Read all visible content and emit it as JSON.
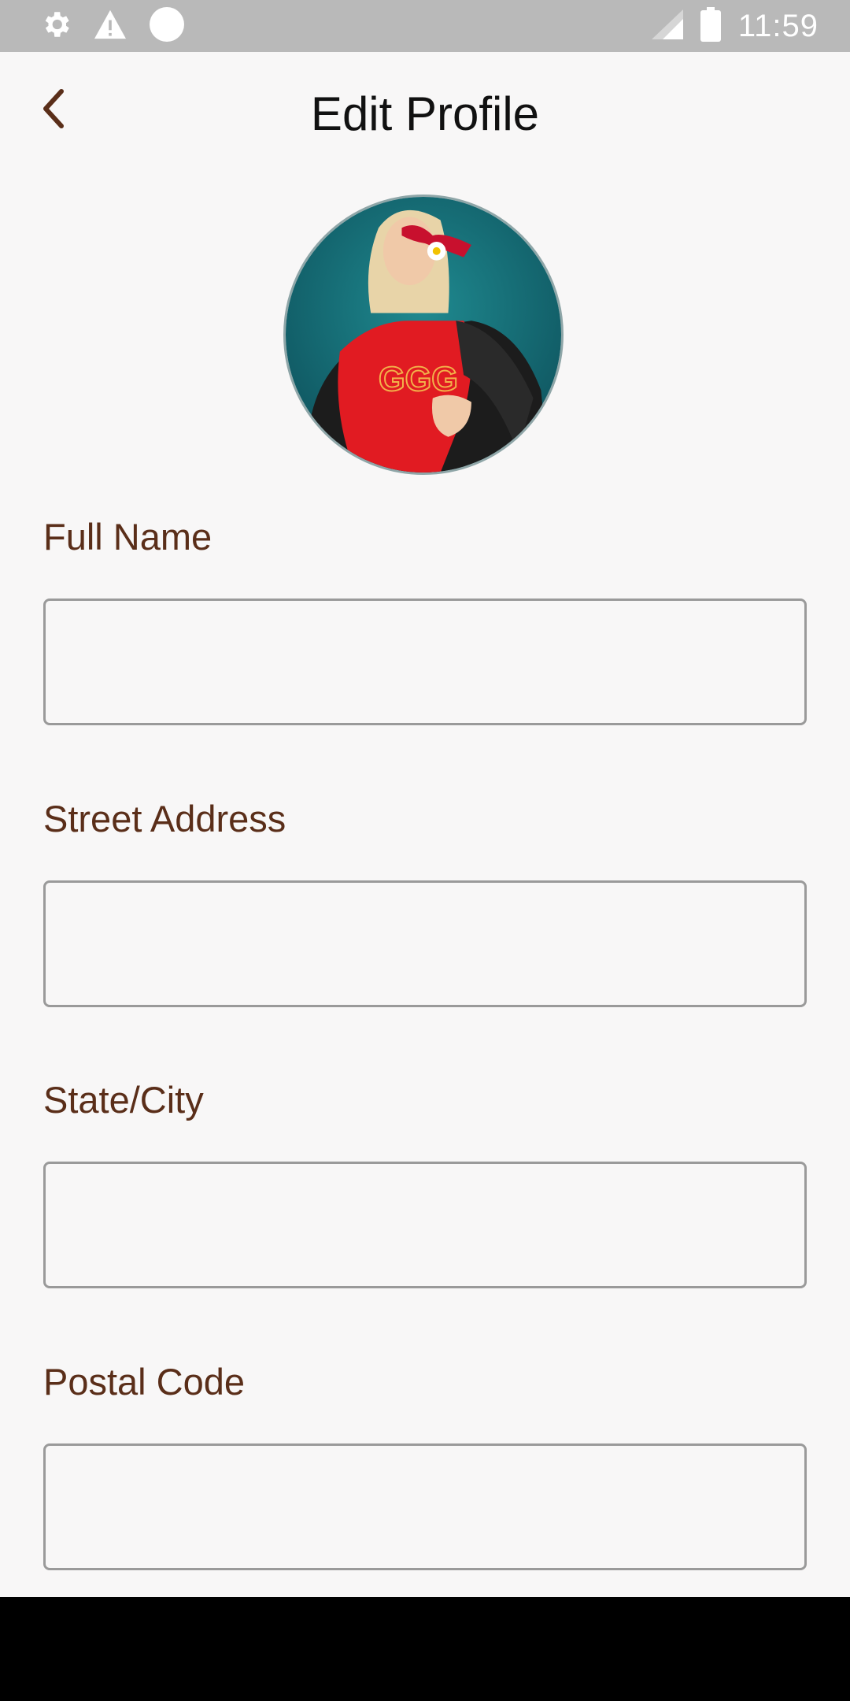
{
  "status_bar": {
    "time": "11:59",
    "icons": [
      "settings-icon",
      "warning-icon",
      "circle-icon",
      "signal-icon",
      "battery-icon"
    ]
  },
  "header": {
    "title": "Edit Profile",
    "back_icon": "chevron-left-icon"
  },
  "profile": {
    "avatar": "profile-photo"
  },
  "form": {
    "fields": [
      {
        "label": "Full Name",
        "value": "",
        "placeholder": ""
      },
      {
        "label": "Street Address",
        "value": "",
        "placeholder": ""
      },
      {
        "label": "State/City",
        "value": "",
        "placeholder": ""
      },
      {
        "label": "Postal Code",
        "value": "",
        "placeholder": ""
      }
    ]
  },
  "colors": {
    "label": "#5a2e19",
    "accent_back": "#5a2e19",
    "status_bar": "#b9b9b9",
    "background": "#f8f7f7"
  }
}
